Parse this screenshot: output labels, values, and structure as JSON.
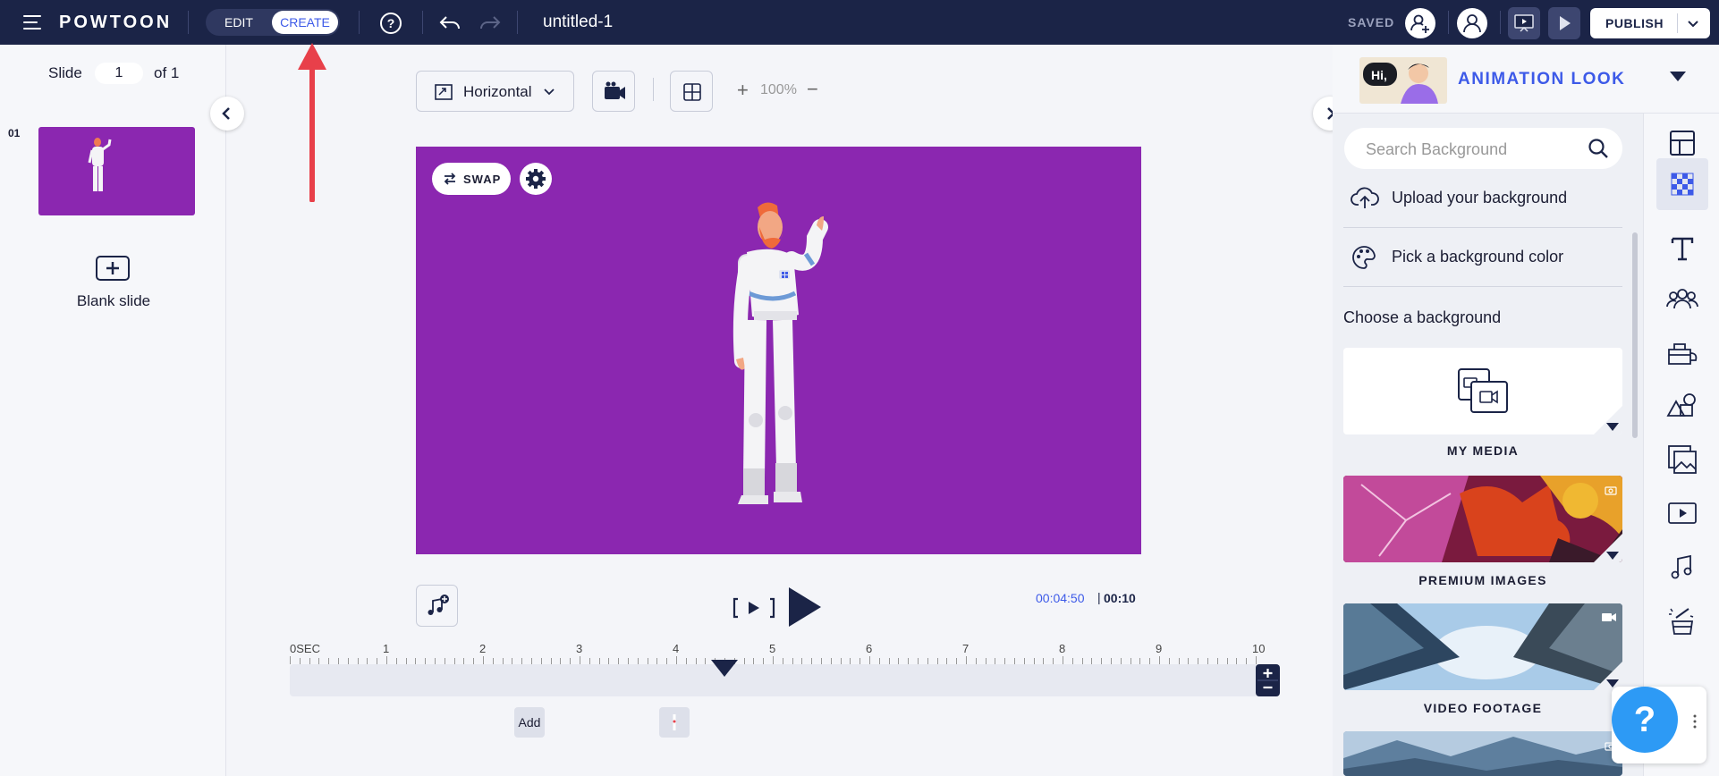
{
  "topbar": {
    "logo": "POWTOON",
    "mode_edit": "EDIT",
    "mode_create": "CREATE",
    "doc_title": "untitled-1",
    "saved_label": "SAVED",
    "publish_label": "PUBLISH"
  },
  "slides_panel": {
    "slide_label": "Slide",
    "current_slide": "1",
    "of_label": "of 1",
    "slide_index": "01",
    "blank_slide_label": "Blank slide"
  },
  "canvas_toolbar": {
    "orientation": "Horizontal",
    "zoom_value": "100%",
    "zoom_plus": "+",
    "zoom_minus": "−"
  },
  "stage": {
    "swap_label": "SWAP",
    "background_color": "#8b27b0"
  },
  "playback": {
    "current_time": "00:04:50",
    "separator": "|",
    "total_time": "00:10"
  },
  "timeline": {
    "tick_labels": [
      "0SEC",
      "1",
      "2",
      "3",
      "4",
      "5",
      "6",
      "7",
      "8",
      "9",
      "10"
    ],
    "add_label": "Add",
    "playhead_seconds": 4.5
  },
  "right_panel": {
    "look_title": "ANIMATION LOOK",
    "look_thumb_text": "Hi,",
    "search_placeholder": "Search Background",
    "upload_label": "Upload your background",
    "pick_color_label": "Pick a background color",
    "choose_label": "Choose a background",
    "cards": [
      {
        "label": "MY MEDIA"
      },
      {
        "label": "PREMIUM IMAGES"
      },
      {
        "label": "VIDEO FOOTAGE"
      }
    ],
    "rail_icons": [
      "layout-icon",
      "background-icon",
      "text-icon",
      "characters-icon",
      "props-icon",
      "shapes-icon",
      "images-icon",
      "video-icon",
      "music-icon",
      "magic-icon"
    ]
  },
  "help": {
    "label": "?"
  },
  "colors": {
    "topbar": "#1b2447",
    "accent": "#3d5ae8",
    "stage": "#8b27b0",
    "annotation": "#e8404a"
  }
}
